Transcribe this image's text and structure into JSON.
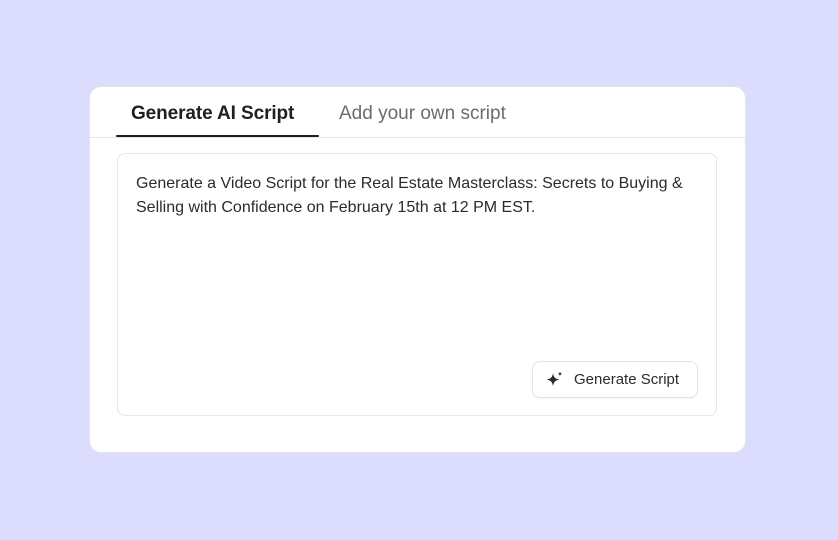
{
  "tabs": [
    {
      "label": "Generate AI Script",
      "active": true
    },
    {
      "label": "Add your own script",
      "active": false
    }
  ],
  "prompt": {
    "text": "Generate a Video Script for the Real Estate Masterclass: Secrets to Buying & Selling with Confidence on February 15th at 12 PM EST."
  },
  "generate_button": {
    "label": "Generate Script",
    "icon": "sparkles-icon"
  },
  "colors": {
    "background": "#dcdcfe",
    "card": "#ffffff",
    "text_primary": "#1e1e24",
    "text_muted": "#6b6b72",
    "border": "#e6e6ec"
  }
}
